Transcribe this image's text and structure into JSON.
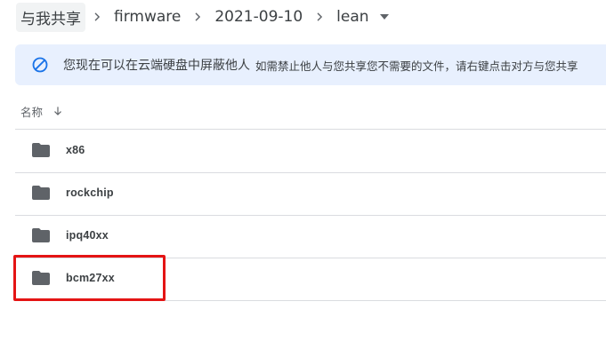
{
  "breadcrumb": {
    "items": [
      "与我共享",
      "firmware",
      "2021-09-10",
      "lean"
    ],
    "chevron_icon": "chevron-right-icon",
    "dropdown_icon": "caret-down-icon"
  },
  "notice": {
    "icon": "block-icon",
    "main_text": "您现在可以在云端硬盘中屏蔽他人",
    "sub_text": "如需禁止他人与您共享您不需要的文件，请右键点击对方与您共享",
    "color": "#e8f0fe",
    "icon_color": "#1a73e8"
  },
  "list_header": {
    "name_label": "名称",
    "sort_icon": "arrow-down-icon"
  },
  "files": [
    {
      "name": "x86",
      "icon": "folder-icon"
    },
    {
      "name": "rockchip",
      "icon": "folder-icon"
    },
    {
      "name": "ipq40xx",
      "icon": "folder-icon"
    },
    {
      "name": "bcm27xx",
      "icon": "folder-icon"
    }
  ],
  "highlight": {
    "color": "#e41414",
    "target": "bcm27xx"
  }
}
